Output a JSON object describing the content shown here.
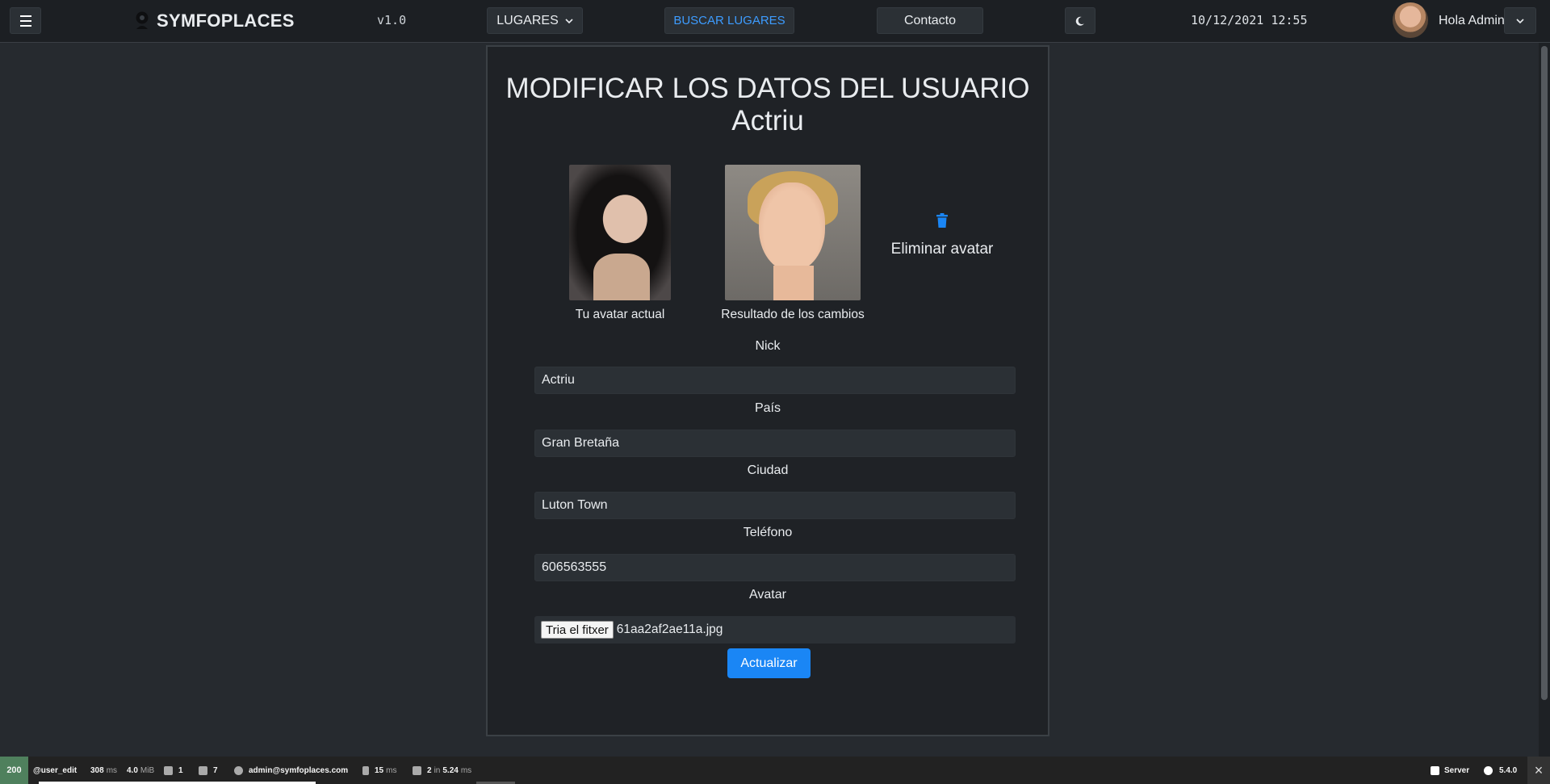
{
  "navbar": {
    "brand": "SYMFOPLACES",
    "version": "v1.0",
    "lugares_label": "LUGARES",
    "buscar_label": "BUSCAR LUGARES",
    "contacto_label": "Contacto",
    "datetime": "10/12/2021 12:55",
    "greeting": "Hola Admin",
    "icons": {
      "menu": "hamburger-icon",
      "logo": "map-pin-icon",
      "theme": "moon-icon",
      "caret": "chevron-down-icon"
    }
  },
  "form": {
    "title": "MODIFICAR LOS DATOS DEL USUARIO Actriu",
    "avatar_current_caption": "Tu avatar actual",
    "avatar_result_caption": "Resultado de los cambios",
    "delete_avatar_label": "Eliminar avatar",
    "fields": {
      "nick": {
        "label": "Nick",
        "value": "Actriu"
      },
      "pais": {
        "label": "País",
        "value": "Gran Bretaña"
      },
      "ciudad": {
        "label": "Ciudad",
        "value": "Luton Town"
      },
      "telefono": {
        "label": "Teléfono",
        "value": "606563555"
      },
      "avatar": {
        "label": "Avatar",
        "button_label": "Tria el fitxer",
        "file_name": "61aa2af2ae11a.jpg"
      }
    },
    "submit_label": "Actualizar",
    "accent_color": "#1a86f5"
  },
  "debug_toolbar": {
    "status": "200",
    "route": "@user_edit",
    "time": "308",
    "time_unit": "ms",
    "memory": "4.0",
    "memory_unit": "MiB",
    "forms": "1",
    "logs": "7",
    "user": "admin@symfoplaces.com",
    "twig_time": "15",
    "twig_unit": "ms",
    "queries": "2",
    "queries_in": "in",
    "queries_time": "5.24",
    "queries_unit": "ms",
    "server": "Server",
    "symfony_version": "5.4.0",
    "status_color": "#4f805d"
  }
}
